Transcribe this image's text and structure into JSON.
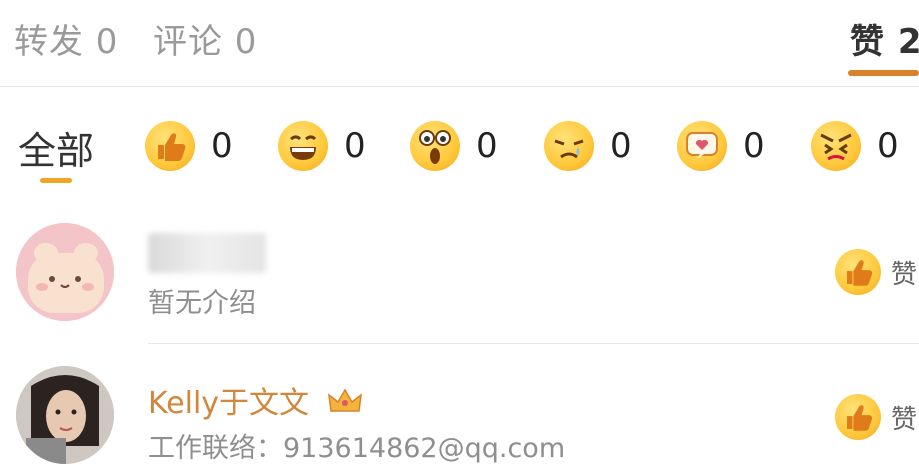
{
  "tabs": {
    "repost": "转发 0",
    "comment": "评论 0",
    "like": "赞 2"
  },
  "filters": {
    "all": "全部",
    "reactions": [
      {
        "icon": "thumbs-up-icon",
        "count": "0"
      },
      {
        "icon": "laughing-icon",
        "count": "0"
      },
      {
        "icon": "surprised-icon",
        "count": "0"
      },
      {
        "icon": "crying-icon",
        "count": "0"
      },
      {
        "icon": "heart-bubble-icon",
        "count": "0"
      },
      {
        "icon": "angry-icon",
        "count": "0"
      }
    ]
  },
  "users": [
    {
      "name": "",
      "desc": "暂无介绍",
      "action": "赞"
    },
    {
      "name": "Kelly于文文",
      "desc": "工作联络：913614862@qq.com",
      "action": "赞"
    }
  ],
  "colors": {
    "accent": "#d9822b",
    "username": "#d2873a",
    "filter_underline": "#f0a623"
  }
}
